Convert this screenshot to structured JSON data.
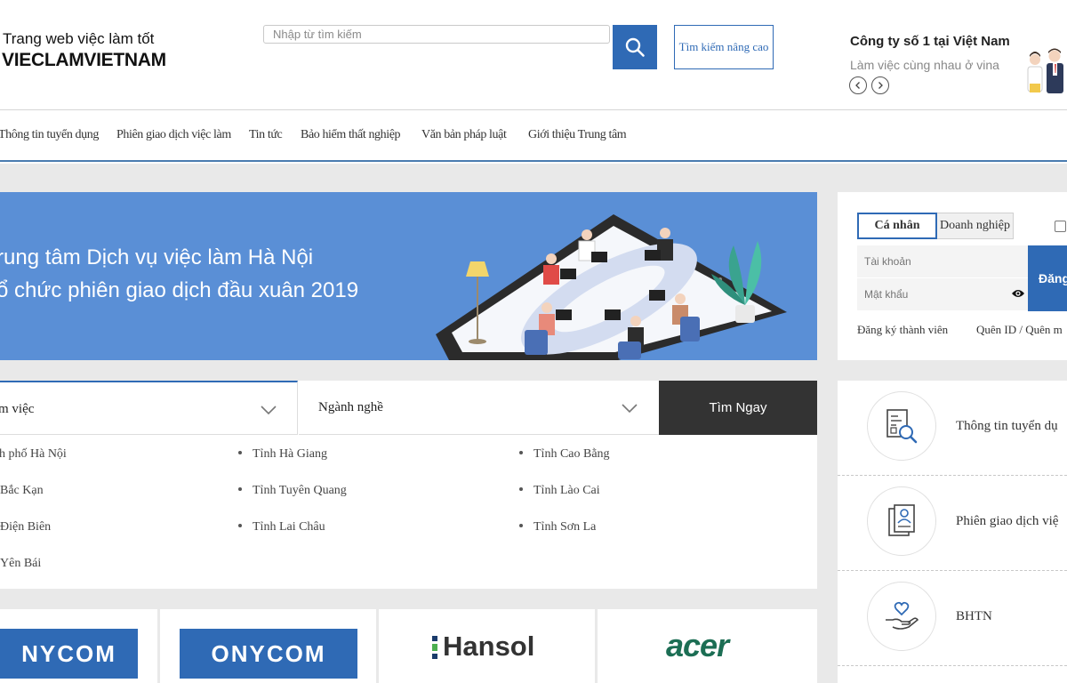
{
  "header": {
    "tagline": "Trang web việc làm tốt",
    "brand": "VIECLAMVIETNAM",
    "search_placeholder": "Nhập từ tìm kiếm",
    "advanced_search": "Tìm kiếm nâng cao",
    "promo_title": "Công ty số 1 tại Việt Nam",
    "promo_subtitle": "Làm việc cùng nhau ở vina"
  },
  "nav": {
    "items": [
      "Thông tin tuyển dụng",
      "Phiên giao dịch việc làm",
      "Tin tức",
      "Bảo hiểm thất nghiệp",
      "Văn bản pháp luật",
      "Giới thiệu Trung tâm"
    ]
  },
  "banner": {
    "line1": "rung tâm Dịch vụ việc làm Hà Nội",
    "line2": "ổ chức phiên giao dịch đầu xuân 2019"
  },
  "login": {
    "tab_personal": "Cá nhân",
    "tab_business": "Doanh nghiệp",
    "username_placeholder": "Tài khoản",
    "password_placeholder": "Mật khẩu",
    "login_button": "Đăng",
    "register": "Đăng ký thành viên",
    "forgot": "Quên ID / Quên m"
  },
  "search": {
    "location_select": "m việc",
    "industry_select": "Ngành nghề",
    "find_button": "Tìm Ngay",
    "locations": [
      [
        "h phố Hà Nội",
        "Tỉnh Hà Giang",
        "Tỉnh Cao Bằng"
      ],
      [
        "Bắc Kạn",
        "Tỉnh Tuyên Quang",
        "Tỉnh Lào Cai"
      ],
      [
        "Điện Biên",
        "Tỉnh Lai Châu",
        "Tỉnh Sơn La"
      ],
      [
        "Yên Bái"
      ]
    ]
  },
  "partners": {
    "onycom1": "NYCOM",
    "onycom2": "ONYCOM",
    "hansol": "Hansol",
    "acer": "acer"
  },
  "services": {
    "items": [
      "Thông tin tuyển dụ",
      "Phiên giao dịch việ",
      "BHTN"
    ]
  },
  "colors": {
    "primary": "#2f6ab5",
    "banner": "#5a8fd6",
    "dark_button": "#333333",
    "page_bg": "#e9e9e9"
  }
}
